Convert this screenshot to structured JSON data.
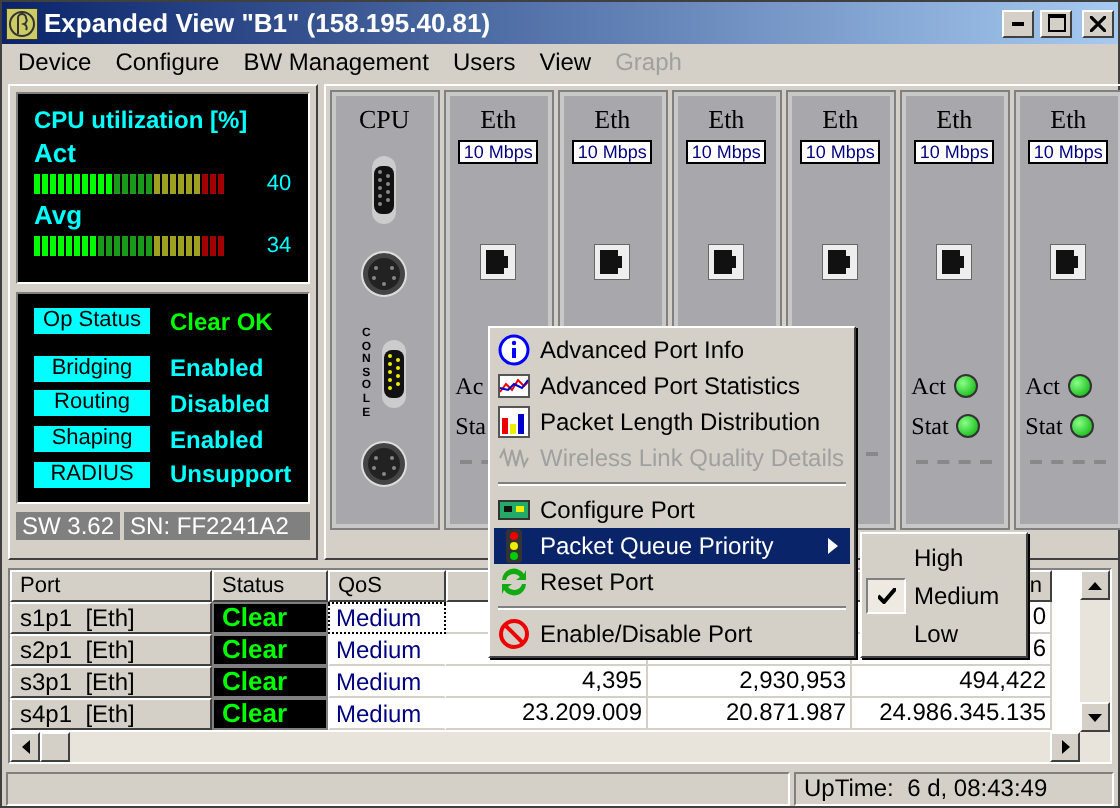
{
  "window": {
    "title": "Expanded View \"B1\" (158.195.40.81)"
  },
  "menu": [
    {
      "label": "Device",
      "disabled": false
    },
    {
      "label": "Configure",
      "disabled": false
    },
    {
      "label": "BW Management",
      "disabled": false
    },
    {
      "label": "Users",
      "disabled": false
    },
    {
      "label": "View",
      "disabled": false
    },
    {
      "label": "Graph",
      "disabled": true
    }
  ],
  "cpu": {
    "title": "CPU utilization [%]",
    "meters": [
      {
        "label": "Act",
        "level": 0.4,
        "reading": "40"
      },
      {
        "label": "Avg",
        "level": 0.34,
        "reading": "34"
      }
    ]
  },
  "status_panel": {
    "items": [
      {
        "label": "Op Status",
        "value": "Clear OK",
        "color": "#00ff00"
      },
      {
        "label": "Bridging",
        "value": "Enabled",
        "color": "#00ffff"
      },
      {
        "label": "Routing",
        "value": "Disabled",
        "color": "#00ffff"
      },
      {
        "label": "Shaping",
        "value": "Enabled",
        "color": "#00ffff"
      },
      {
        "label": "RADIUS",
        "value": "Unsupport",
        "color": "#00ffff"
      }
    ],
    "software": "SW 3.62",
    "serial": "SN: FF2241A2"
  },
  "cpu_slot": {
    "title": "CPU",
    "console_label": "CONSOLE"
  },
  "slots": [
    {
      "title": "Eth",
      "speed": "10 Mbps",
      "leds": [
        {
          "label": "Ac"
        },
        {
          "label": "Sta"
        }
      ]
    },
    {
      "title": "Eth",
      "speed": "10 Mbps"
    },
    {
      "title": "Eth",
      "speed": "10 Mbps"
    },
    {
      "title": "Eth",
      "speed": "10 Mbps"
    },
    {
      "title": "Eth",
      "speed": "10 Mbps",
      "leds": [
        {
          "label": "Act",
          "on": true
        },
        {
          "label": "Stat",
          "on": true
        }
      ]
    },
    {
      "title": "Eth",
      "speed": "10 Mbps",
      "leds": [
        {
          "label": "Act",
          "on": true
        },
        {
          "label": "Stat",
          "on": true
        }
      ]
    }
  ],
  "table": {
    "columns": [
      "Port",
      "Status",
      "QoS",
      null,
      null,
      "n"
    ],
    "rows": [
      {
        "port": "s1p1  [Eth]",
        "status": "Clear",
        "qos": "Medium",
        "focused": true,
        "column_6": "0"
      },
      {
        "port": "s2p1  [Eth]",
        "status": "Clear",
        "qos": "Medium",
        "focused": false,
        "column_6": "6"
      },
      {
        "port": "s3p1  [Eth]",
        "status": "Clear",
        "qos": "Medium",
        "focused": false,
        "column_4": "4,395",
        "column_5": "2,930,953",
        "column_6": "494,422"
      },
      {
        "port": "s4p1  [Eth]",
        "status": "Clear",
        "qos": "Medium",
        "focused": false,
        "column_4": "23.209.009",
        "column_5": "20.871.987",
        "column_6": "24.986.345.135"
      }
    ]
  },
  "context_menu": {
    "items": [
      {
        "kind": "item",
        "label": "Advanced Port Info",
        "disabled": false,
        "selected": false
      },
      {
        "kind": "item",
        "label": "Advanced Port Statistics",
        "disabled": false,
        "selected": false
      },
      {
        "kind": "item",
        "label": "Packet Length Distribution",
        "disabled": false,
        "selected": false
      },
      {
        "kind": "item",
        "label": "Wireless Link Quality Details",
        "disabled": true,
        "selected": false
      },
      {
        "kind": "separator"
      },
      {
        "kind": "item",
        "label": "Configure Port",
        "disabled": false,
        "selected": false
      },
      {
        "kind": "submenu",
        "label": "Packet Queue Priority",
        "disabled": false,
        "selected": true
      },
      {
        "kind": "item",
        "label": "Reset Port",
        "disabled": false,
        "selected": false
      },
      {
        "kind": "separator"
      },
      {
        "kind": "item",
        "label": "Enable/Disable Port",
        "disabled": false,
        "selected": false
      }
    ],
    "submenu": [
      {
        "label": "High",
        "checked": false
      },
      {
        "label": "Medium",
        "checked": true
      },
      {
        "label": "Low",
        "checked": false
      }
    ]
  },
  "status_bar": {
    "uptime": "UpTime:  6 d, 08:43:49"
  }
}
